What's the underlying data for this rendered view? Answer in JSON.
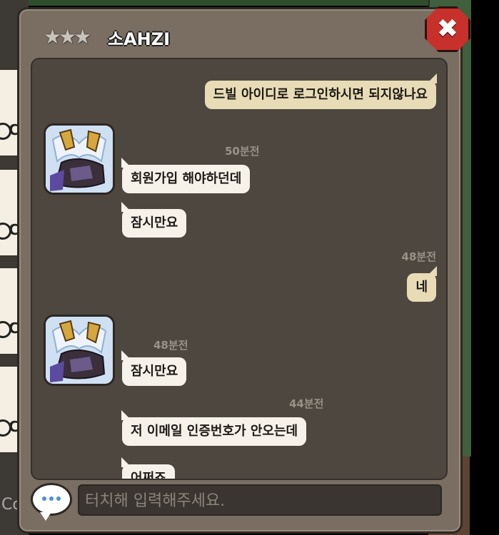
{
  "header": {
    "stars": "★★★",
    "title": "소AHZI",
    "close_label": "✖"
  },
  "messages": [
    {
      "text": "드빌 아이디로 로그인하시면 되지않나요"
    },
    {
      "time": "50분전",
      "text": "회원가입 해야하던데"
    },
    {
      "text": "잠시만요"
    },
    {
      "time": "48분전",
      "text": "네"
    },
    {
      "time": "48분전",
      "text": "잠시만요"
    },
    {
      "time": "44분전",
      "text": "저 이메일 인증번호가 안오는데"
    },
    {
      "text": "어쩌죠"
    }
  ],
  "input": {
    "placeholder": "터치해 입력해주세요."
  },
  "side": {
    "tab_letter": "C",
    "bottom_text": "Co"
  }
}
